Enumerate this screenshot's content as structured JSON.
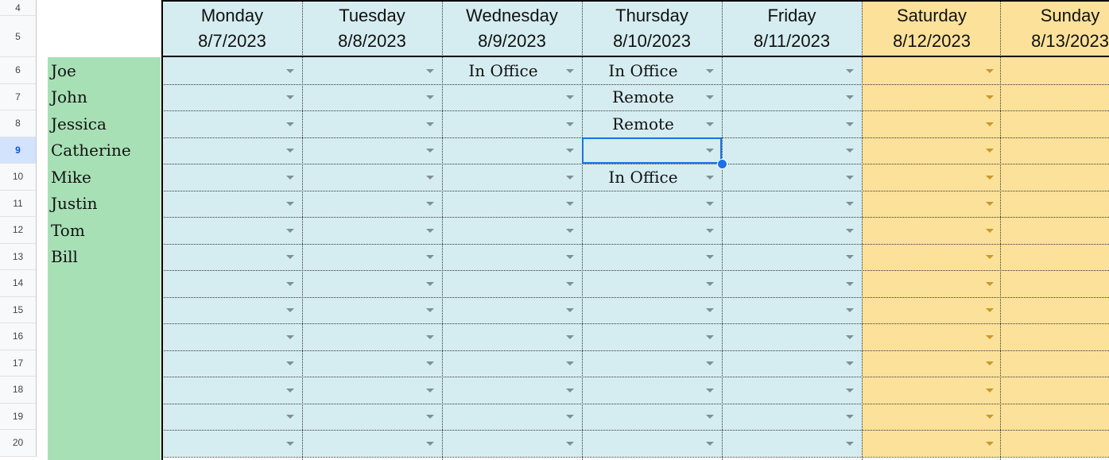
{
  "rows": [
    "4",
    "5",
    "6",
    "7",
    "8",
    "9",
    "10",
    "11",
    "12",
    "13",
    "14",
    "15",
    "16",
    "17",
    "18",
    "19",
    "20"
  ],
  "selected_row": "9",
  "days": [
    {
      "name": "Monday",
      "date": "8/7/2023",
      "weekend": false
    },
    {
      "name": "Tuesday",
      "date": "8/8/2023",
      "weekend": false
    },
    {
      "name": "Wednesday",
      "date": "8/9/2023",
      "weekend": false
    },
    {
      "name": "Thursday",
      "date": "8/10/2023",
      "weekend": false
    },
    {
      "name": "Friday",
      "date": "8/11/2023",
      "weekend": false
    },
    {
      "name": "Saturday",
      "date": "8/12/2023",
      "weekend": true
    },
    {
      "name": "Sunday",
      "date": "8/13/2023",
      "weekend": true
    }
  ],
  "names": [
    "Joe",
    "John",
    "Jessica",
    "Catherine",
    "Mike",
    "Justin",
    "Tom",
    "Bill"
  ],
  "entries": [
    [
      "",
      "",
      "In Office",
      "In Office",
      "",
      "",
      ""
    ],
    [
      "",
      "",
      "",
      "Remote",
      "",
      "",
      ""
    ],
    [
      "",
      "",
      "",
      "Remote",
      "",
      "",
      ""
    ],
    [
      "",
      "",
      "",
      "",
      "",
      "",
      ""
    ],
    [
      "",
      "",
      "",
      "In Office",
      "",
      "",
      ""
    ],
    [
      "",
      "",
      "",
      "",
      "",
      "",
      ""
    ],
    [
      "",
      "",
      "",
      "",
      "",
      "",
      ""
    ],
    [
      "",
      "",
      "",
      "",
      "",
      "",
      ""
    ],
    [
      "",
      "",
      "",
      "",
      "",
      "",
      ""
    ],
    [
      "",
      "",
      "",
      "",
      "",
      "",
      ""
    ],
    [
      "",
      "",
      "",
      "",
      "",
      "",
      ""
    ],
    [
      "",
      "",
      "",
      "",
      "",
      "",
      ""
    ],
    [
      "",
      "",
      "",
      "",
      "",
      "",
      ""
    ],
    [
      "",
      "",
      "",
      "",
      "",
      "",
      ""
    ],
    [
      "",
      "",
      "",
      "",
      "",
      "",
      ""
    ]
  ],
  "selected_cell": {
    "row": 3,
    "col": 3
  },
  "colors": {
    "weekday": "#d5edf0",
    "weekend": "#fce19a",
    "names": "#a8e0b6",
    "selection": "#1a73e8"
  }
}
